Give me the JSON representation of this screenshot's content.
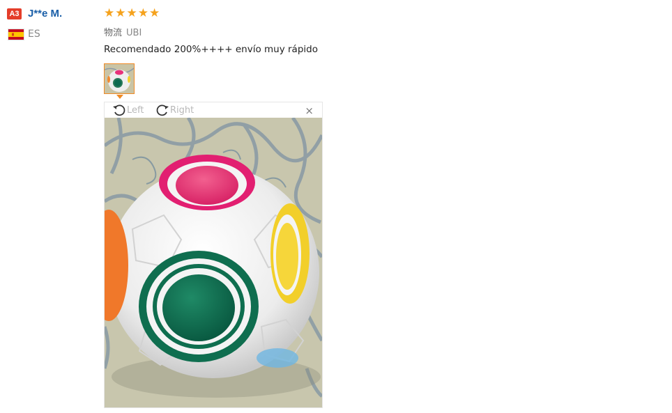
{
  "reviewer": {
    "badge": "A3",
    "name": "J**e M.",
    "country": "ES",
    "flag_icon": "spain-flag-icon"
  },
  "rating": {
    "stars": 5,
    "max": 5,
    "star_char": "★",
    "color": "#f5a21d"
  },
  "shipping": {
    "label": "物流",
    "value": "UBI"
  },
  "review_text": "Recomendado 200%++++ envío muy rápido",
  "viewer": {
    "rotate_left_label": "Left",
    "rotate_right_label": "Right",
    "close_label": "×"
  },
  "colors": {
    "accent": "#f08a24",
    "username": "#1a5fa8",
    "badge": "#e43d2a"
  }
}
